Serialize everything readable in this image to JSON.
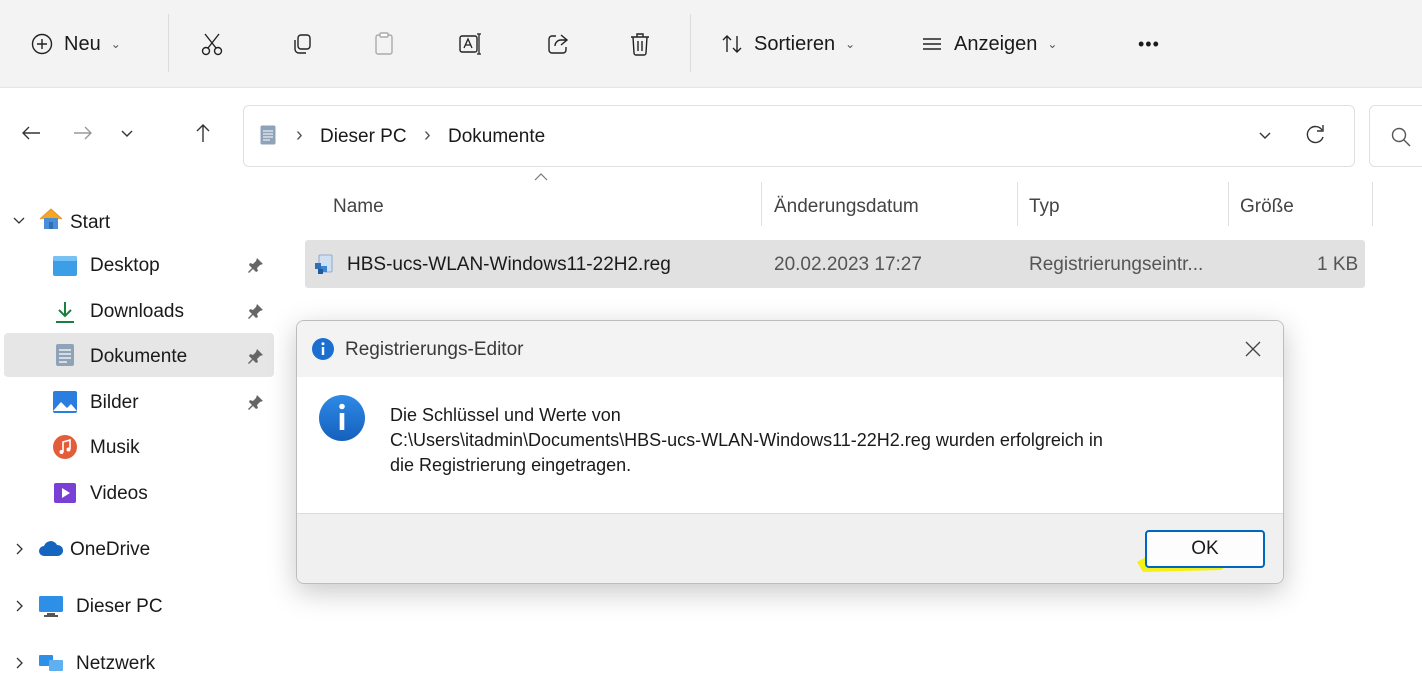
{
  "toolbar": {
    "new_label": "Neu",
    "sort_label": "Sortieren",
    "view_label": "Anzeigen",
    "more_label": "•••",
    "icons": [
      "plus-circle-icon",
      "scissors-icon",
      "copy-icon",
      "paste-icon",
      "rename-icon",
      "share-icon",
      "trash-icon",
      "sort-icon",
      "view-lines-icon",
      "more-icon"
    ]
  },
  "address": {
    "crumbs": [
      "Dieser PC",
      "Dokumente"
    ]
  },
  "sidebar": {
    "items": [
      {
        "label": "Start",
        "icon": "home-icon"
      },
      {
        "label": "Desktop",
        "icon": "desktop-folder-icon"
      },
      {
        "label": "Downloads",
        "icon": "download-icon"
      },
      {
        "label": "Dokumente",
        "icon": "documents-icon"
      },
      {
        "label": "Bilder",
        "icon": "pictures-icon"
      },
      {
        "label": "Musik",
        "icon": "music-icon"
      },
      {
        "label": "Videos",
        "icon": "videos-icon"
      },
      {
        "label": "OneDrive",
        "icon": "cloud-icon"
      },
      {
        "label": "Dieser PC",
        "icon": "monitor-icon"
      },
      {
        "label": "Netzwerk",
        "icon": "network-icon"
      }
    ]
  },
  "file_list": {
    "columns": [
      "Name",
      "Änderungsdatum",
      "Typ",
      "Größe"
    ],
    "rows": [
      {
        "name": "HBS-ucs-WLAN-Windows11-22H2.reg",
        "date": "20.02.2023 17:27",
        "type": "Registrierungseintr...",
        "size": "1 KB"
      }
    ]
  },
  "dialog": {
    "title": "Registrierungs-Editor",
    "message_line1": "Die Schlüssel und Werte von",
    "message_line2": "C:\\Users\\itadmin\\Documents\\HBS-ucs-WLAN-Windows11-22H2.reg wurden erfolgreich in",
    "message_line3": "die Registrierung eingetragen.",
    "ok_label": "OK"
  },
  "colors": {
    "accent": "#0067c0",
    "highlight": "#f4f000",
    "info_blue": "#1a6fd0"
  }
}
